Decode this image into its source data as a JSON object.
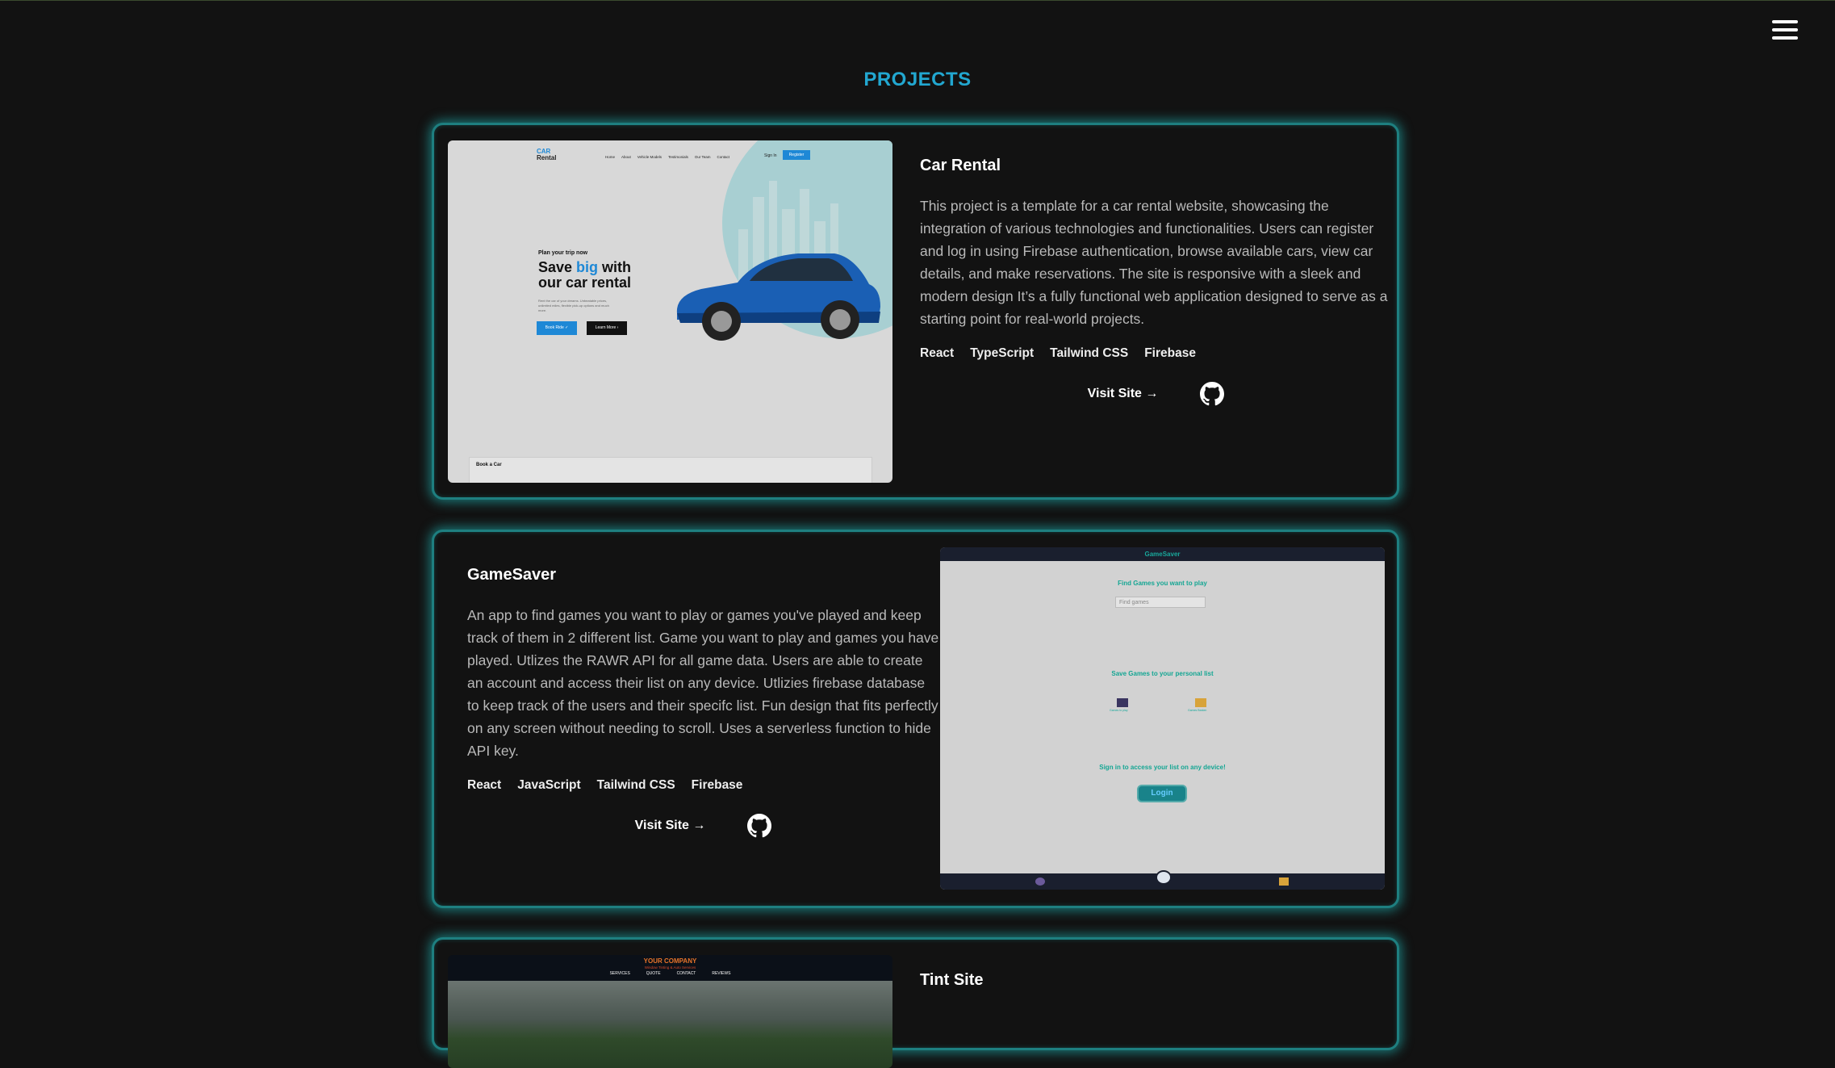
{
  "page": {
    "title": "PROJECTS"
  },
  "projects": [
    {
      "title": "Car Rental",
      "description": "This project is a template for a car rental website, showcasing the integration of various technologies and functionalities. Users can register and log in using Firebase authentication, browse available cars, view car details, and make reservations. The site is responsive with a sleek and modern design It’s a fully functional web application designed to serve as a starting point for real-world projects.",
      "tags": [
        "React",
        "TypeScript",
        "Tailwind CSS",
        "Firebase"
      ],
      "visit_label": "Visit Site →",
      "screenshot": {
        "logo_top": "CAR",
        "logo_bottom": "Rental",
        "nav": [
          "Home",
          "About",
          "Vehicle Models",
          "Testimonials",
          "Our Team",
          "Contact"
        ],
        "sign_in": "Sign In",
        "register": "Register",
        "hero_sub": "Plan your trip now",
        "hero_title_1": "Save ",
        "hero_highlight": "big",
        "hero_title_2": " with",
        "hero_title_3": "our car rental",
        "hero_text": "Rent the car of your dreams. Unbeatable prices, unlimited miles, flexible pick-up options and much more.",
        "book_ride": "Book Ride ✓",
        "learn_more": "Learn More ›",
        "book_title": "Book a Car"
      }
    },
    {
      "title": "GameSaver",
      "description": "An app to find games you want to play or games you've played and keep track of them in 2 different list. Game you want to play and games you have played. Utlizes the RAWR API for all game data. Users are able to create an account and access their list on any device. Utlizies firebase database to keep track of the users and their specifc list. Fun design that fits perfectly on any screen without needing to scroll. Uses a serverless function to hide API key.",
      "tags": [
        "React",
        "JavaScript",
        "Tailwind CSS",
        "Firebase"
      ],
      "visit_label": "Visit Site →",
      "screenshot": {
        "app_title": "GameSaver",
        "find_heading": "Find Games you want to play",
        "search_placeholder": "Find games",
        "save_heading": "Save Games to your personal list",
        "want_label": "Games to play",
        "played_label": "Games Beaten",
        "signin_heading": "Sign in to access your list on any device!",
        "login_label": "Login"
      }
    },
    {
      "title": "Tint Site",
      "screenshot": {
        "company": "YOUR COMPANY",
        "tagline": "Window Tinting & Auto Services",
        "nav": [
          "SERVICES",
          "QUOTE",
          "CONTACT",
          "REVIEWS"
        ]
      }
    }
  ],
  "colors": {
    "accent": "#22a7d0",
    "glow": "#1e7f80",
    "background": "#121212"
  },
  "icons": {
    "menu": "hamburger-menu-icon",
    "github": "github-icon"
  }
}
